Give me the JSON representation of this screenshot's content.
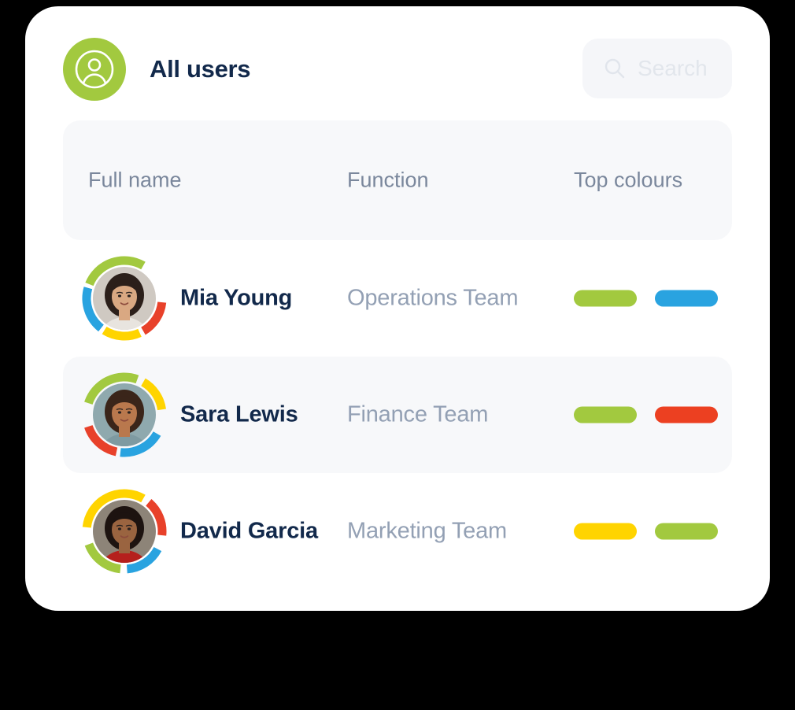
{
  "page": {
    "background_color": "#000000",
    "card_background": "#ffffff"
  },
  "header": {
    "title": "All users",
    "avatar_icon": "user-circle-icon",
    "avatar_bg_color": "#a2c93f",
    "title_color": "#12294b"
  },
  "search": {
    "placeholder": "Search",
    "value": "",
    "icon": "search-icon",
    "bg_color": "#f5f6f9",
    "text_color": "#dfe3ea"
  },
  "table": {
    "header_bg_color": "#f7f8fa",
    "header_text_color": "#7a879c",
    "alt_row_bg_color": "#f7f8fa",
    "columns": [
      {
        "key": "full_name",
        "label": "Full name"
      },
      {
        "key": "function",
        "label": "Function"
      },
      {
        "key": "top_colours",
        "label": "Top colours"
      }
    ],
    "rows": [
      {
        "full_name": "Mia Young",
        "function": "Operations Team",
        "top_colours": [
          "#a2c93f",
          "#29a3e0"
        ],
        "avatar": {
          "name": "avatar-mia-young",
          "hair_color": "#2b1f1a",
          "skin_color": "#d9a882",
          "bg_color": "#cfc9c2",
          "clothing_color": "#e8e4df",
          "ring_segments": [
            {
              "color": "#a2c93f",
              "start": 292,
              "end": 30
            },
            {
              "color": "#e8412a",
              "start": 96,
              "end": 150
            },
            {
              "color": "#ffd400",
              "start": 156,
              "end": 212
            },
            {
              "color": "#29a3e0",
              "start": 218,
              "end": 286
            }
          ]
        }
      },
      {
        "full_name": "Sara Lewis",
        "function": "Finance Team",
        "top_colours": [
          "#a2c93f",
          "#ec4021"
        ],
        "avatar": {
          "name": "avatar-sara-lewis",
          "hair_color": "#3a251a",
          "skin_color": "#b9784d",
          "bg_color": "#8fa9ae",
          "clothing_color": "#7e9aa1",
          "ring_segments": [
            {
              "color": "#a2c93f",
              "start": 288,
              "end": 20
            },
            {
              "color": "#ffd400",
              "start": 30,
              "end": 82
            },
            {
              "color": "#29a3e0",
              "start": 120,
              "end": 186
            },
            {
              "color": "#e8412a",
              "start": 192,
              "end": 252
            }
          ]
        }
      },
      {
        "full_name": "David Garcia",
        "function": "Marketing Team",
        "top_colours": [
          "#ffd400",
          "#a2c93f"
        ],
        "avatar": {
          "name": "avatar-david-garcia",
          "hair_color": "#1d1310",
          "skin_color": "#9a6440",
          "bg_color": "#8d8478",
          "clothing_color": "#b5201d",
          "ring_segments": [
            {
              "color": "#ffd400",
              "start": 276,
              "end": 30
            },
            {
              "color": "#e8412a",
              "start": 40,
              "end": 96
            },
            {
              "color": "#29a3e0",
              "start": 118,
              "end": 176
            },
            {
              "color": "#a2c93f",
              "start": 186,
              "end": 250
            }
          ]
        }
      }
    ]
  },
  "palette": {
    "green": "#a2c93f",
    "blue": "#29a3e0",
    "yellow": "#ffd400",
    "red": "#e8412a",
    "navy": "#12294b",
    "muted": "#93a0b4"
  }
}
